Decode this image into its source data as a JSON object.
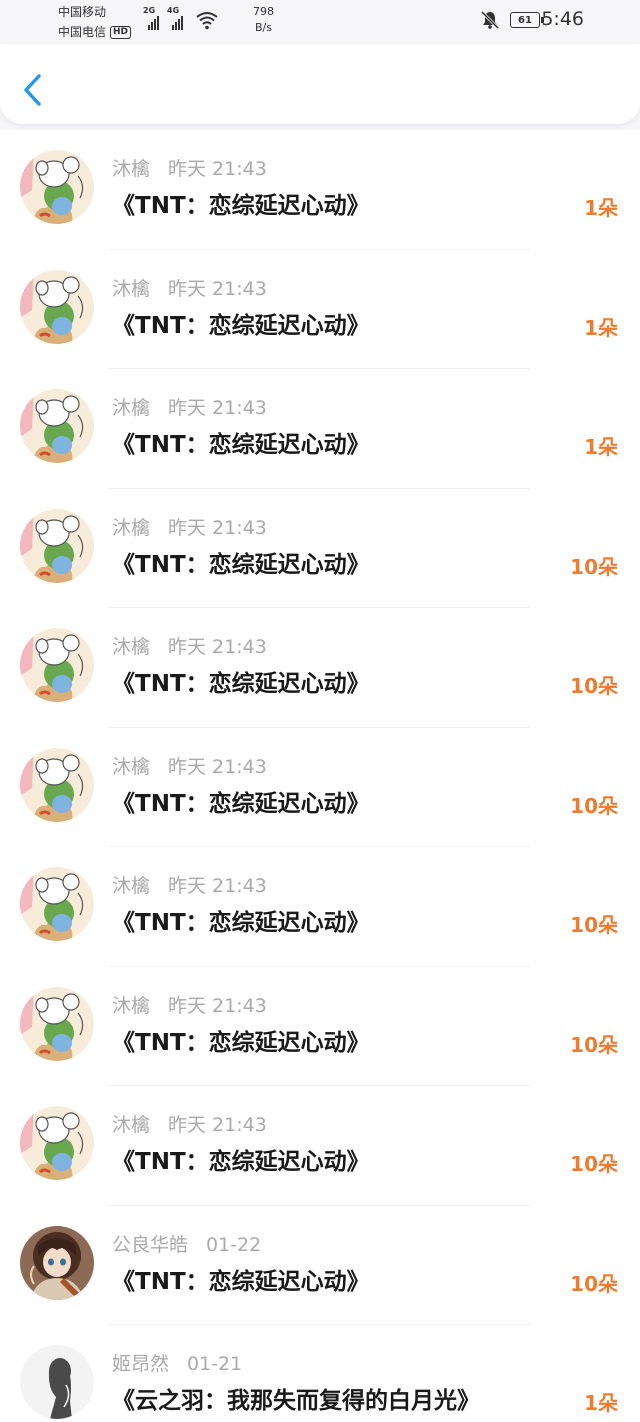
{
  "status_bar": {
    "carrier_1": "中国移动",
    "carrier_2": "中国电信",
    "hd_badge": "HD",
    "sim1_network": "2G",
    "sim2_network": "4G",
    "net_speed_value": "798",
    "net_speed_unit": "B/s",
    "battery_level": "61",
    "time": "5:46"
  },
  "colors": {
    "accent": "#2196f3",
    "count": "#f07a2e",
    "meta_text": "#aaaaaa"
  },
  "gifts": [
    {
      "name": "沐檎",
      "time": "昨天 21:43",
      "title": "《TNT：恋综延迟心动》",
      "count": "1朵",
      "avatar": "mouse-avatar"
    },
    {
      "name": "沐檎",
      "time": "昨天 21:43",
      "title": "《TNT：恋综延迟心动》",
      "count": "1朵",
      "avatar": "mouse-avatar"
    },
    {
      "name": "沐檎",
      "time": "昨天 21:43",
      "title": "《TNT：恋综延迟心动》",
      "count": "1朵",
      "avatar": "mouse-avatar"
    },
    {
      "name": "沐檎",
      "time": "昨天 21:43",
      "title": "《TNT：恋综延迟心动》",
      "count": "10朵",
      "avatar": "mouse-avatar"
    },
    {
      "name": "沐檎",
      "time": "昨天 21:43",
      "title": "《TNT：恋综延迟心动》",
      "count": "10朵",
      "avatar": "mouse-avatar"
    },
    {
      "name": "沐檎",
      "time": "昨天 21:43",
      "title": "《TNT：恋综延迟心动》",
      "count": "10朵",
      "avatar": "mouse-avatar"
    },
    {
      "name": "沐檎",
      "time": "昨天 21:43",
      "title": "《TNT：恋综延迟心动》",
      "count": "10朵",
      "avatar": "mouse-avatar"
    },
    {
      "name": "沐檎",
      "time": "昨天 21:43",
      "title": "《TNT：恋综延迟心动》",
      "count": "10朵",
      "avatar": "mouse-avatar"
    },
    {
      "name": "沐檎",
      "time": "昨天 21:43",
      "title": "《TNT：恋综延迟心动》",
      "count": "10朵",
      "avatar": "mouse-avatar"
    },
    {
      "name": "公良华皓",
      "time": "01-22",
      "title": "《TNT：恋综延迟心动》",
      "count": "10朵",
      "avatar": "anime-girl-avatar"
    },
    {
      "name": "姬昂然",
      "time": "01-21",
      "title": "《云之羽：我那失而复得的白月光》",
      "count": "1朵",
      "avatar": "silhouette-avatar"
    }
  ]
}
